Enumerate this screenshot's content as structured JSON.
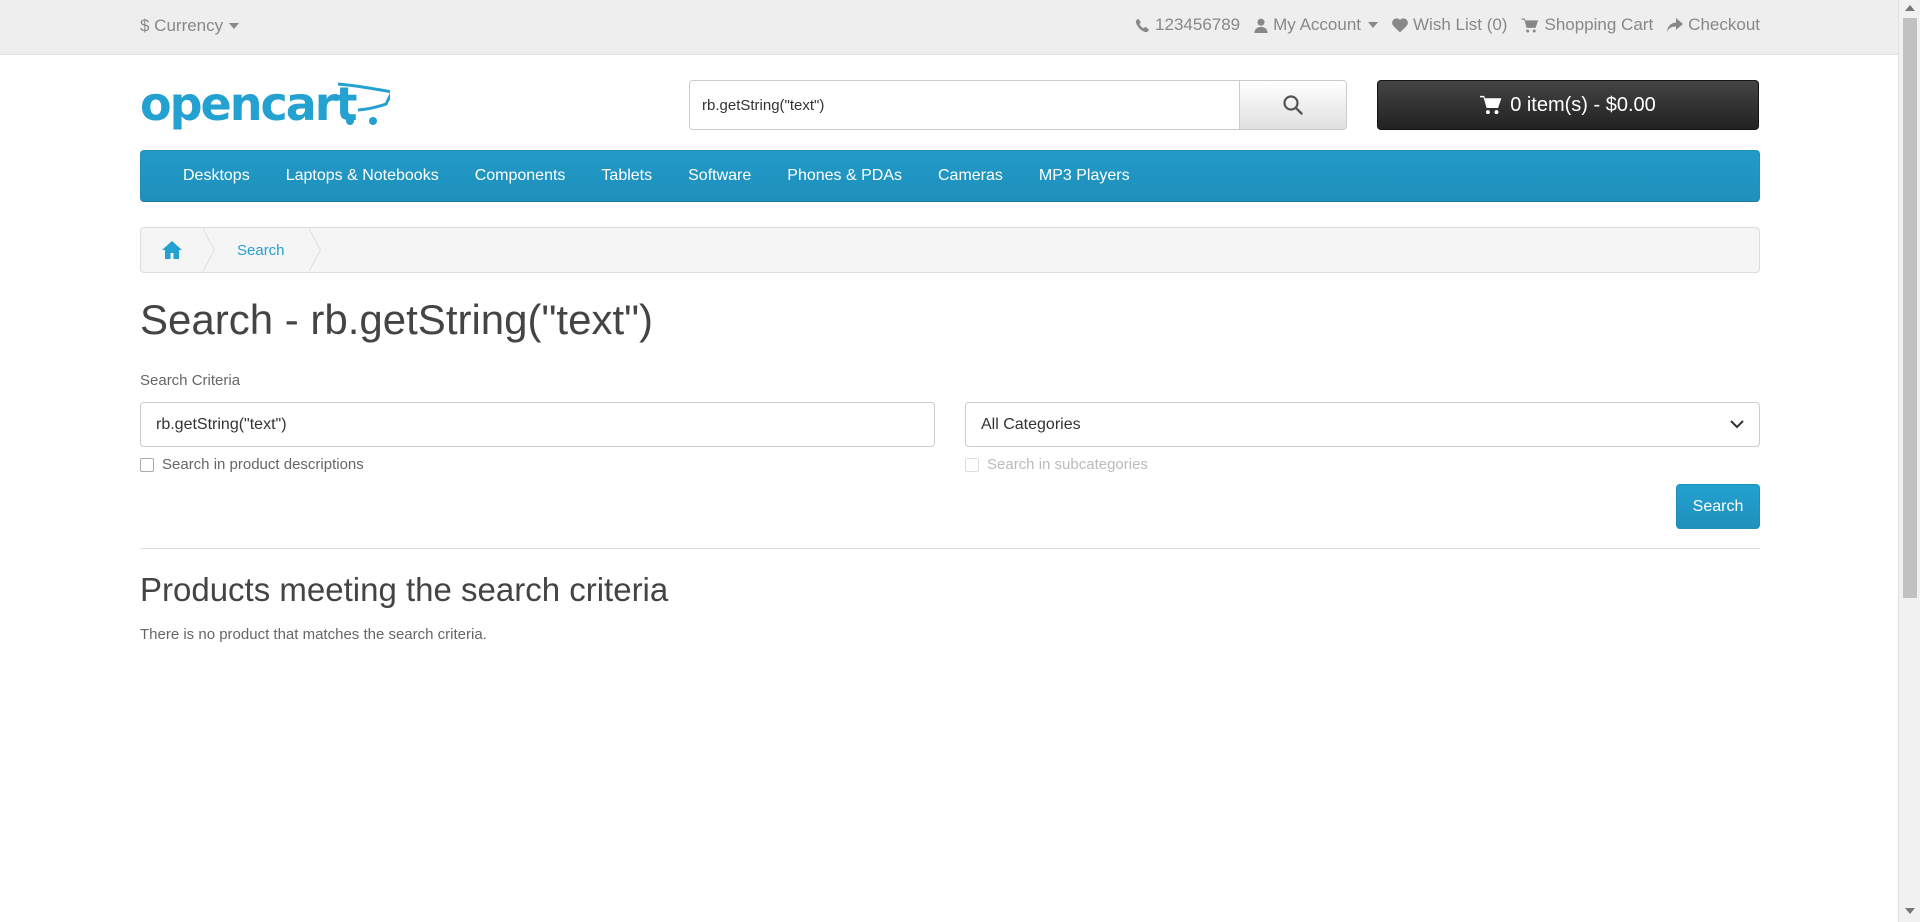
{
  "topbar": {
    "currency_label": "$ Currency",
    "phone": "123456789",
    "my_account": "My Account",
    "wish_list": "Wish List (0)",
    "shopping_cart": "Shopping Cart",
    "checkout": "Checkout"
  },
  "header": {
    "logo_text": "opencart",
    "search_value": "rb.getString(\"text\")",
    "cart_label": "0 item(s) - $0.00"
  },
  "menu": {
    "items": [
      "Desktops",
      "Laptops & Notebooks",
      "Components",
      "Tablets",
      "Software",
      "Phones & PDAs",
      "Cameras",
      "MP3 Players"
    ]
  },
  "breadcrumb": {
    "current": "Search"
  },
  "content": {
    "page_title": "Search - rb.getString(\"text\")",
    "criteria_label": "Search Criteria",
    "criteria_value": "rb.getString(\"text\")",
    "category_selected": "All Categories",
    "search_descriptions_label": "Search in product descriptions",
    "search_subcategories_label": "Search in subcategories",
    "search_button": "Search",
    "results_heading": "Products meeting the search criteria",
    "no_results": "There is no product that matches the search criteria."
  },
  "colors": {
    "accent": "#23a1d1",
    "menu_bg": "#229ac8",
    "cart_bg": "#333333"
  }
}
